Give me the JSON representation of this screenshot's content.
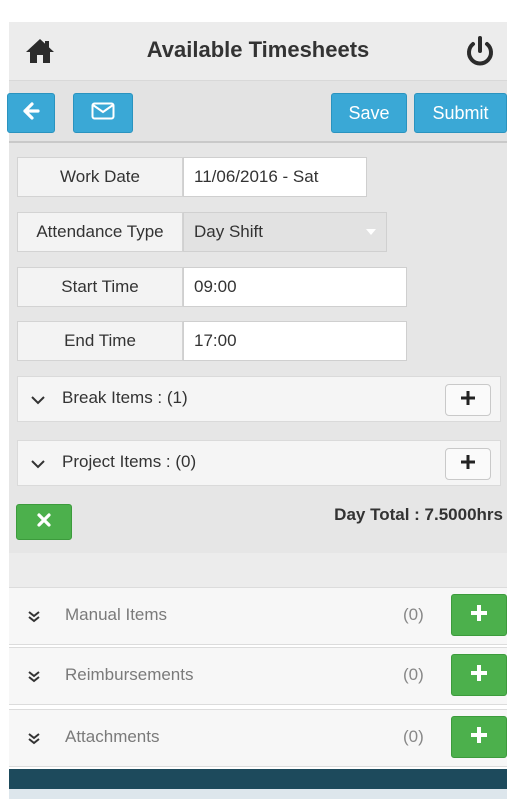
{
  "header": {
    "title": "Available Timesheets",
    "home_icon": "home-icon",
    "power_icon": "power-icon"
  },
  "toolbar": {
    "back_icon": "arrow-left-icon",
    "mail_icon": "envelope-icon",
    "save_label": "Save",
    "submit_label": "Submit"
  },
  "form": {
    "work_date_label": "Work Date",
    "work_date_value": "11/06/2016 - Sat",
    "attendance_type_label": "Attendance Type",
    "attendance_type_value": "Day Shift",
    "start_time_label": "Start Time",
    "start_time_value": "09:00",
    "end_time_label": "End Time",
    "end_time_value": "17:00"
  },
  "groups": {
    "break_items": "Break Items : (1)",
    "project_items": "Project Items : (0)"
  },
  "day_total": "Day Total : 7.5000hrs",
  "sections": [
    {
      "label": "Manual Items",
      "count": "(0)"
    },
    {
      "label": "Reimbursements",
      "count": "(0)"
    },
    {
      "label": "Attachments",
      "count": "(0)"
    }
  ],
  "colors": {
    "primary_blue": "#3aa8d6",
    "success_green": "#4cb04c",
    "footer_dark": "#1d4a5c"
  }
}
